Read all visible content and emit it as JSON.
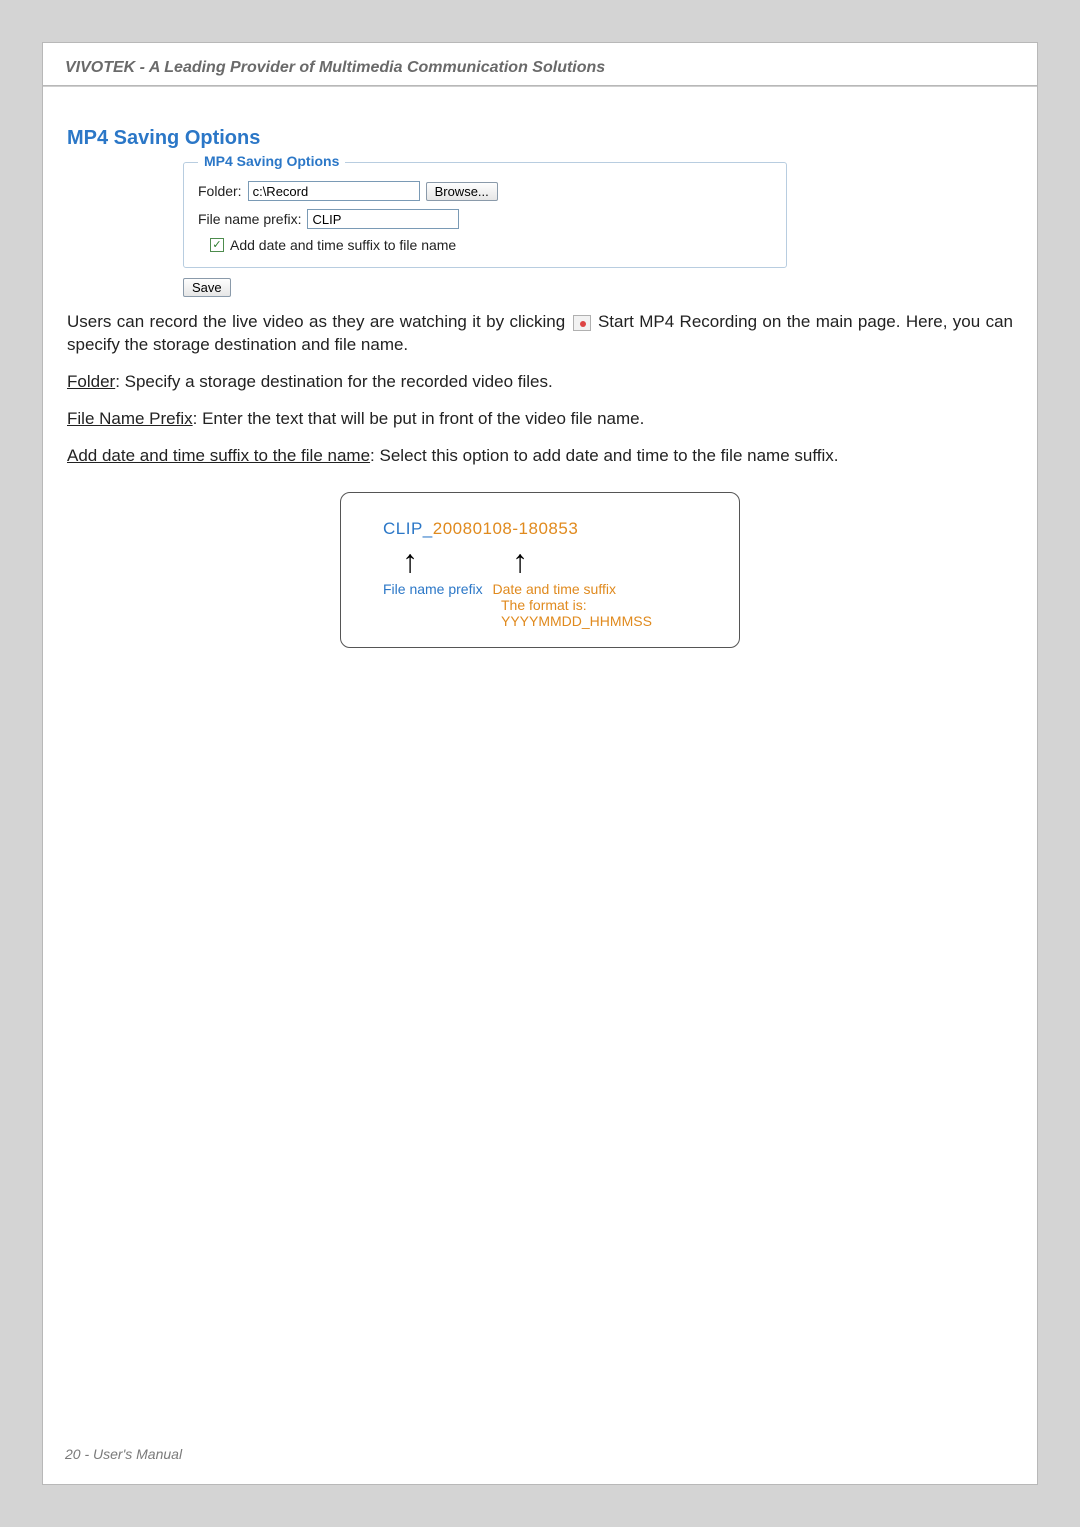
{
  "header": {
    "title": "VIVOTEK - A Leading Provider of Multimedia Communication Solutions"
  },
  "section": {
    "title": "MP4 Saving Options",
    "legend": "MP4 Saving Options",
    "folder_label": "Folder:",
    "folder_value": "c:\\Record",
    "browse_label": "Browse...",
    "prefix_label": "File name prefix:",
    "prefix_value": "CLIP",
    "checkbox_label": "Add date and time suffix to file name",
    "checkbox_checked": true,
    "save_label": "Save"
  },
  "paragraphs": {
    "intro_before_icon": "Users can record the live video as they are watching it by clicking ",
    "intro_after_icon": " Start MP4 Recording on the main page. Here, you can specify the storage destination and file name.",
    "folder_term": "Folder",
    "folder_desc": ": Specify a storage destination for the recorded video files.",
    "prefix_term": "File Name Prefix",
    "prefix_desc": ": Enter the text that will be put in front of the video file name.",
    "suffix_term": "Add date and time suffix to the file name",
    "suffix_desc": ": Select this option to add date and time to the file name suffix."
  },
  "diagram": {
    "prefix": "CLIP_",
    "suffix": "20080108-180853",
    "label_prefix": "File name prefix",
    "label_suffix": "Date and time suffix",
    "format": "The format is: YYYYMMDD_HHMMSS"
  },
  "footer": {
    "text": "20 - User's Manual"
  }
}
